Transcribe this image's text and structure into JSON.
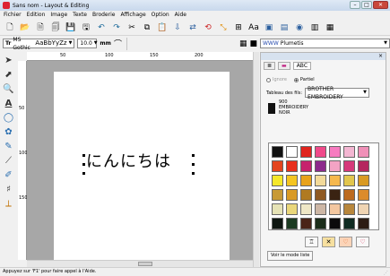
{
  "window": {
    "title": "Sans nom - Layout & Editing",
    "min": "–",
    "max": "□",
    "close": "✕"
  },
  "menu": [
    "Fichier",
    "Edition",
    "Image",
    "Texte",
    "Broderie",
    "Affichage",
    "Option",
    "Aide"
  ],
  "toolbar": {
    "icons": [
      "new-doc",
      "open-folder",
      "open-file",
      "import",
      "save",
      "save-as",
      "undo",
      "redo",
      "cut",
      "copy",
      "paste",
      "send",
      "transfer",
      "rotate",
      "pick",
      "arrange",
      "text-fit",
      "applique",
      "window",
      "zoom",
      "hoop",
      "preview"
    ]
  },
  "fontbar": {
    "font_name": "MS Gothic",
    "font_preview": "AaBbYyZz",
    "size_value": "10.0",
    "size_unit": "mm",
    "stitch_label": "Plumetis"
  },
  "canvas": {
    "text": "にんにちは",
    "ruler_top": [
      "50",
      "100",
      "150",
      "200"
    ],
    "ruler_left": [
      "50",
      "100",
      "150"
    ]
  },
  "panel": {
    "close": "×",
    "tab_abc": "ABC",
    "radio_ignore": "Ignore",
    "radio_partiel": "Partiel",
    "thread_table_label": "Tableau des fils:",
    "thread_table_value": "BROTHER EMBROIDERY",
    "thread_lines": [
      "900",
      "EMBROIDERY",
      "NOIR"
    ],
    "view_button": "Voir le mode liste",
    "palette": [
      "#111111",
      "#ffffff",
      "#e0241d",
      "#f04a8a",
      "#f77bc0",
      "#f3b6d2",
      "#f090b8",
      "#e4451f",
      "#e8301e",
      "#c6216d",
      "#8d2a8c",
      "#f3a3c4",
      "#d63a7a",
      "#b5255f",
      "#f5e82a",
      "#f4c522",
      "#e8a21a",
      "#f3da9a",
      "#f6b84d",
      "#e2c64e",
      "#d99a23",
      "#c89a36",
      "#d99a25",
      "#b07a21",
      "#8f5a22",
      "#3a2312",
      "#bd6a1e",
      "#dc8b2b",
      "#e6e3b6",
      "#ead77a",
      "#efe7c6",
      "#cdb7a5",
      "#f3c7a0",
      "#b8873d",
      "#efd4b3",
      "#0e1611",
      "#1c3b22",
      "#4a2418",
      "#1b2d1a",
      "#0b0a0c",
      "#0f2b22",
      "#2c1c14"
    ]
  },
  "status": "Appuyez sur 'F1' pour faire appel à l'Aide."
}
